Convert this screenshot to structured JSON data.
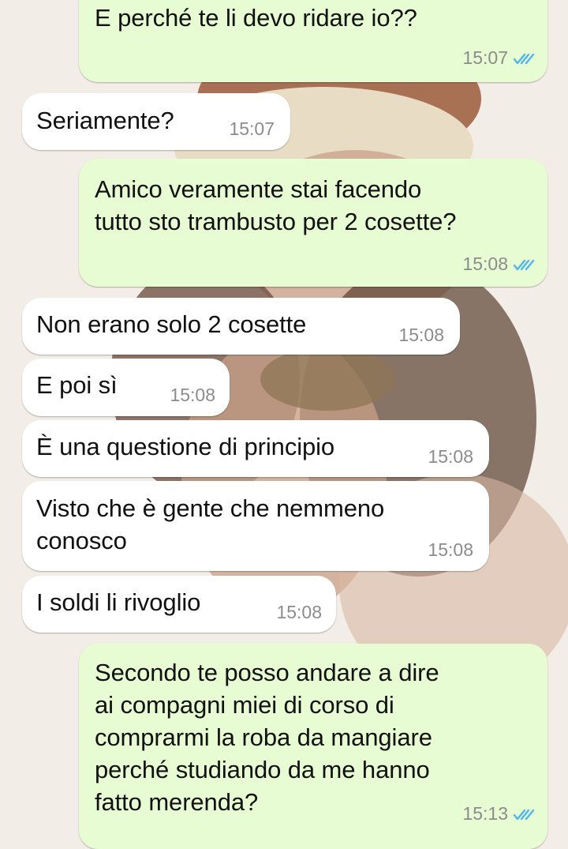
{
  "colors": {
    "outgoing_bubble": "#e7fcd2",
    "incoming_bubble": "#ffffff",
    "timestamp": "#8c8c8c",
    "read_ticks": "#4fb6ec"
  },
  "icons": {
    "read_receipt": "double-check-icon"
  },
  "messages": [
    {
      "direction": "outgoing",
      "text": "E perché te li devo ridare io??",
      "time": "15:07",
      "status": "read"
    },
    {
      "direction": "incoming",
      "text": "Seriamente?",
      "time": "15:07"
    },
    {
      "direction": "outgoing",
      "text": "Amico veramente stai facendo\ntutto sto trambusto per 2 cosette?",
      "time": "15:08",
      "status": "read"
    },
    {
      "direction": "incoming",
      "text": "Non erano solo 2 cosette",
      "time": "15:08"
    },
    {
      "direction": "incoming",
      "text": "E poi sì",
      "time": "15:08"
    },
    {
      "direction": "incoming",
      "text": "È una questione di principio",
      "time": "15:08"
    },
    {
      "direction": "incoming",
      "text": "Visto che è gente che nemmeno\nconosco",
      "time": "15:08"
    },
    {
      "direction": "incoming",
      "text": "I soldi li rivoglio",
      "time": "15:08"
    },
    {
      "direction": "outgoing",
      "text": "Secondo te posso andare a dire\nai compagni miei di corso di\ncomprarmi la roba da mangiare\nperché studiando da me hanno\nfatto merenda?",
      "time": "15:13",
      "status": "read"
    }
  ]
}
